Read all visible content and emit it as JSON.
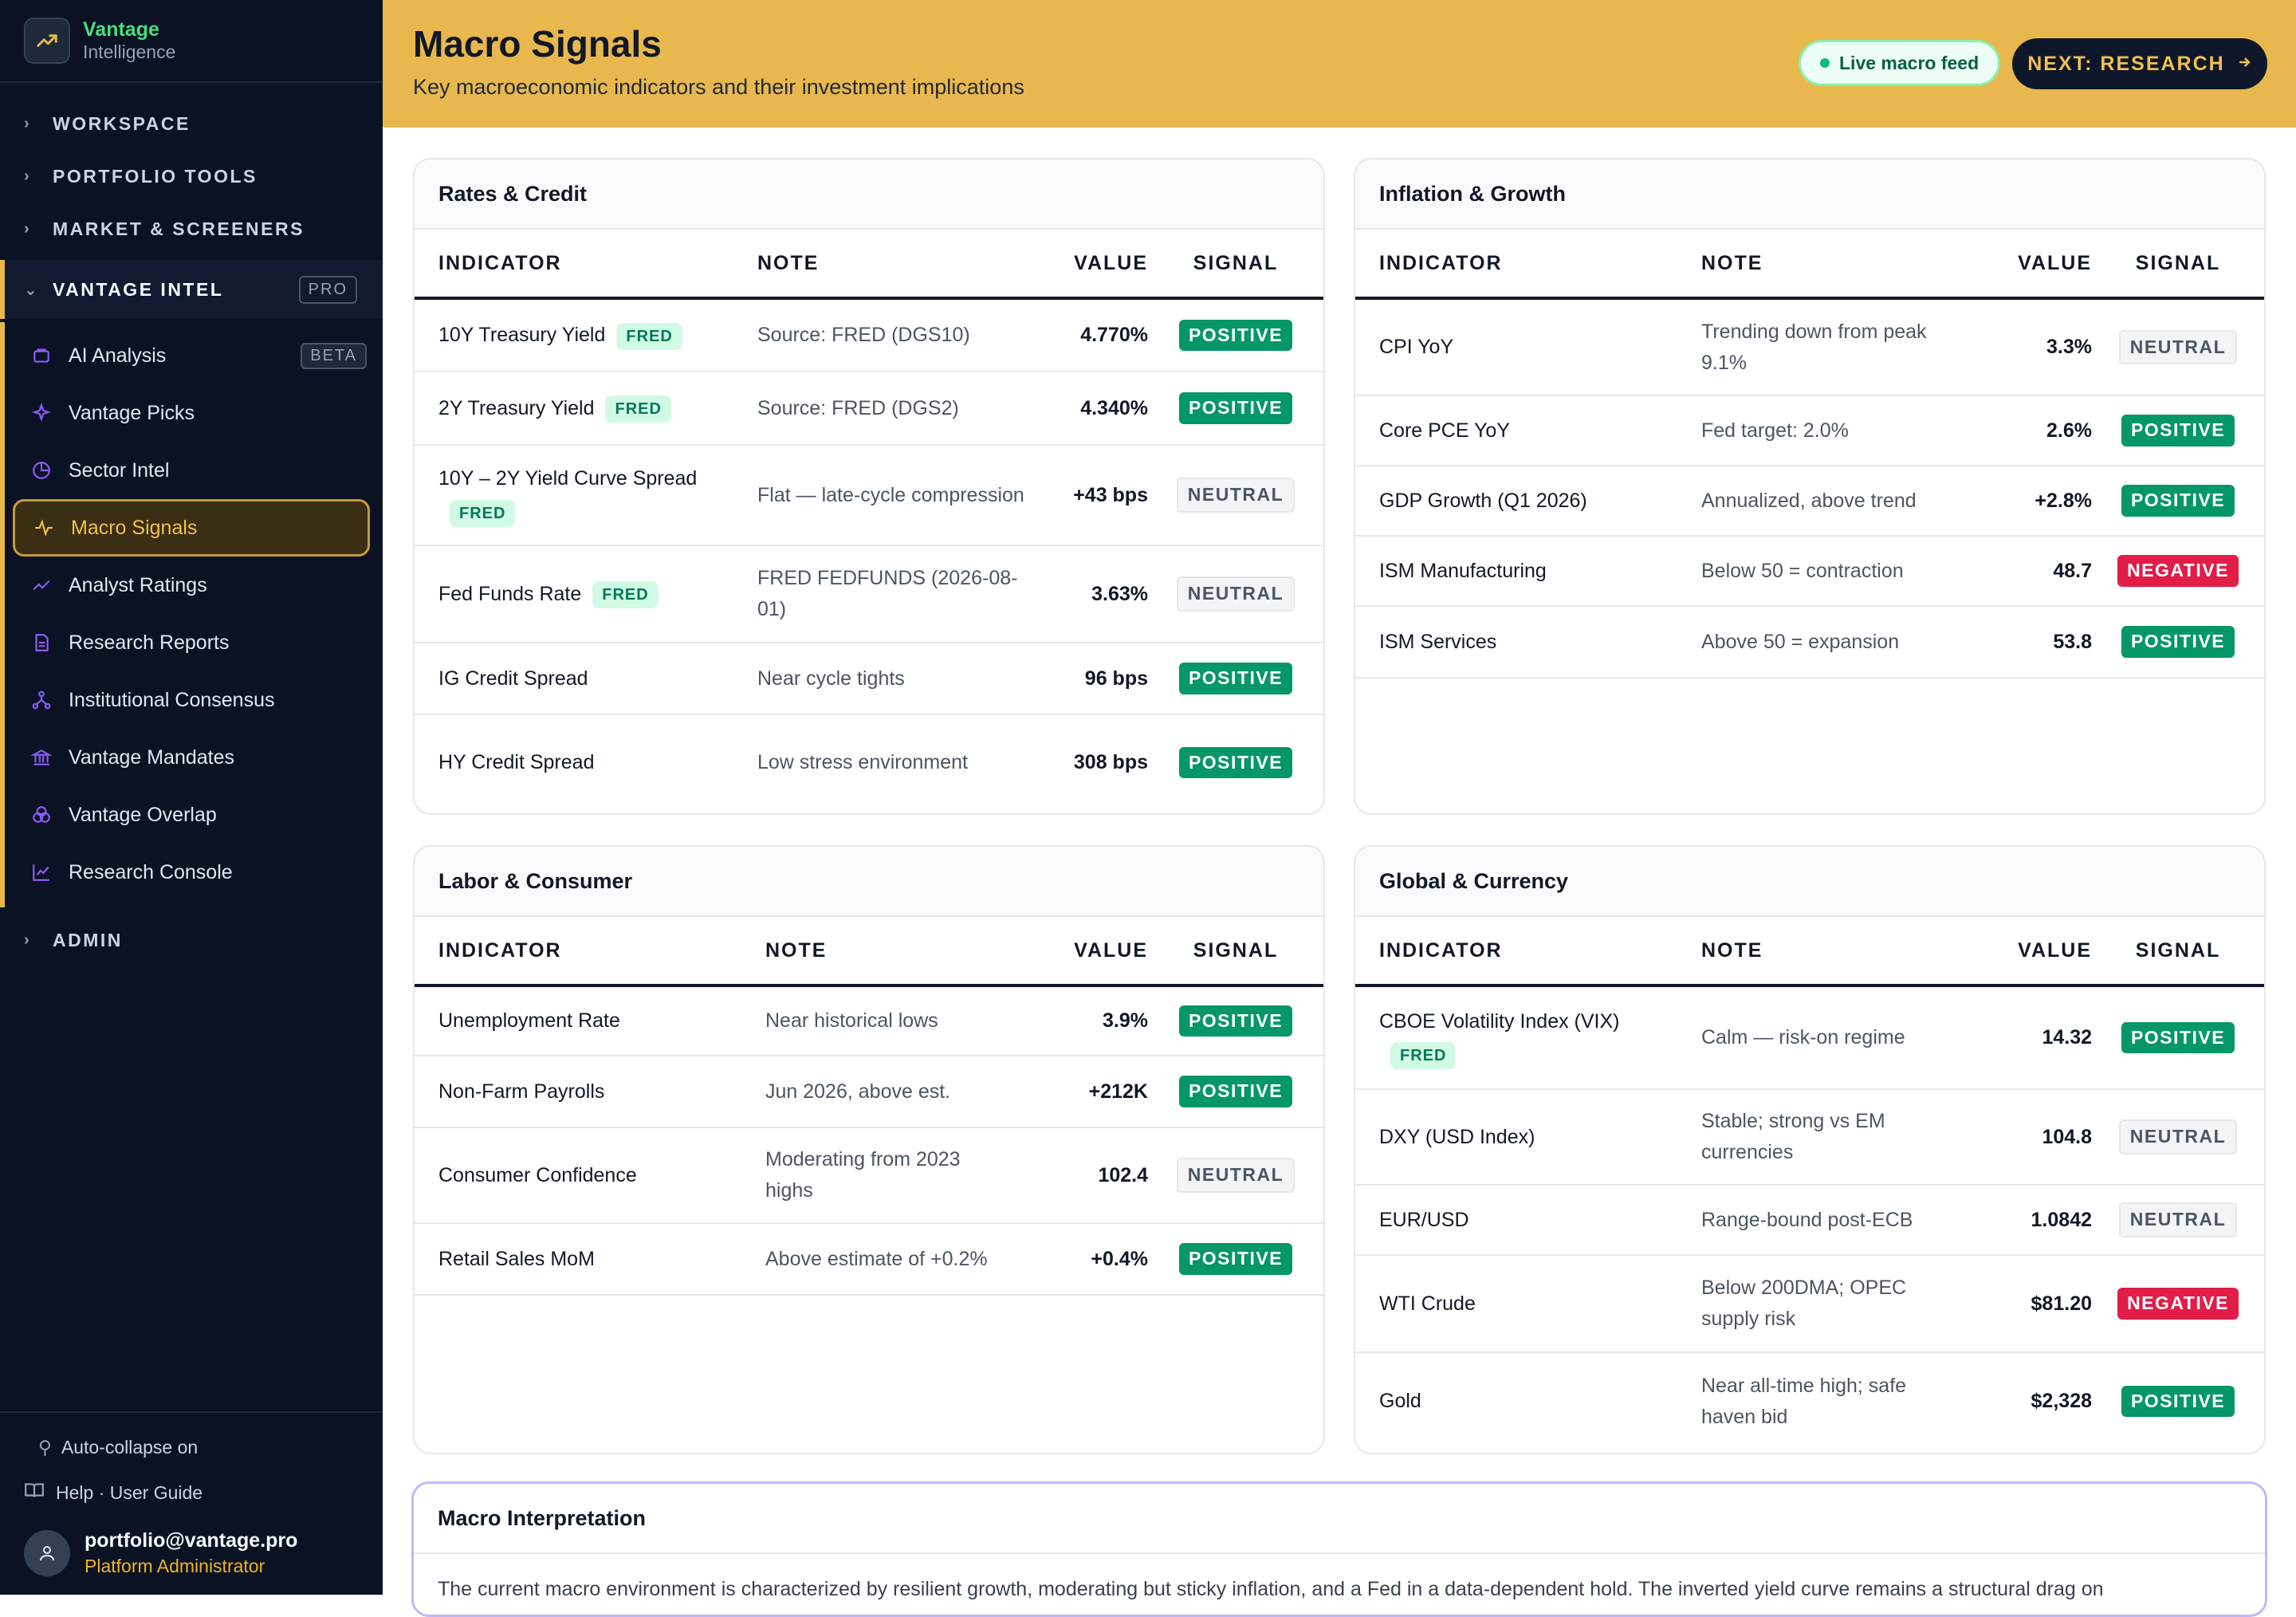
{
  "brand": {
    "name": "Vantage",
    "sub": "Intelligence"
  },
  "sidebar": {
    "sections": [
      "WORKSPACE",
      "PORTFOLIO TOOLS",
      "MARKET & SCREENERS"
    ],
    "active_section": "VANTAGE INTEL",
    "active_section_badge": "PRO",
    "items": [
      {
        "label": "AI Analysis",
        "icon": "ai-analysis-icon",
        "badge": "BETA"
      },
      {
        "label": "Vantage Picks",
        "icon": "sparkle-icon"
      },
      {
        "label": "Sector Intel",
        "icon": "pie-chart-icon"
      },
      {
        "label": "Macro Signals",
        "icon": "activity-icon"
      },
      {
        "label": "Analyst Ratings",
        "icon": "trending-up-icon"
      },
      {
        "label": "Research Reports",
        "icon": "document-icon"
      },
      {
        "label": "Institutional Consensus",
        "icon": "network-icon"
      },
      {
        "label": "Vantage Mandates",
        "icon": "bank-icon"
      },
      {
        "label": "Vantage Overlap",
        "icon": "overlap-icon"
      },
      {
        "label": "Research Console",
        "icon": "line-chart-icon"
      }
    ],
    "admin": "ADMIN",
    "footer": {
      "auto_collapse": "Auto-collapse on",
      "help": "Help · User Guide",
      "email": "portfolio@vantage.pro",
      "role": "Platform Administrator"
    }
  },
  "header": {
    "title": "Macro Signals",
    "subtitle": "Key macroeconomic indicators and their investment implications",
    "live_label": "Live macro feed",
    "next_label": "NEXT: RESEARCH"
  },
  "columns": {
    "indicator": "INDICATOR",
    "note": "NOTE",
    "value": "VALUE",
    "signal": "SIGNAL"
  },
  "signals": {
    "positive": "POSITIVE",
    "neutral": "NEUTRAL",
    "negative": "NEGATIVE"
  },
  "fred_label": "FRED",
  "cards": {
    "rates": {
      "title": "Rates & Credit",
      "rows": [
        {
          "indicator": "10Y Treasury Yield",
          "fred": true,
          "note": "Source: FRED (DGS10)",
          "value": "4.770%",
          "signal": "POSITIVE"
        },
        {
          "indicator": "2Y Treasury Yield",
          "fred": true,
          "note": "Source: FRED (DGS2)",
          "value": "4.340%",
          "signal": "POSITIVE"
        },
        {
          "indicator": "10Y – 2Y Yield Curve Spread",
          "fred": true,
          "note": "Flat — late-cycle compression",
          "value": "+43 bps",
          "signal": "NEUTRAL"
        },
        {
          "indicator": "Fed Funds Rate",
          "fred": true,
          "note": "FRED FEDFUNDS (2026-08-01)",
          "value": "3.63%",
          "signal": "NEUTRAL"
        },
        {
          "indicator": "IG Credit Spread",
          "fred": false,
          "note": "Near cycle tights",
          "value": "96 bps",
          "signal": "POSITIVE"
        },
        {
          "indicator": "HY Credit Spread",
          "fred": false,
          "note": "Low stress environment",
          "value": "308 bps",
          "signal": "POSITIVE"
        }
      ]
    },
    "inflation": {
      "title": "Inflation & Growth",
      "rows": [
        {
          "indicator": "CPI YoY",
          "note": "Trending down from peak 9.1%",
          "value": "3.3%",
          "signal": "NEUTRAL"
        },
        {
          "indicator": "Core PCE YoY",
          "note": "Fed target: 2.0%",
          "value": "2.6%",
          "signal": "POSITIVE"
        },
        {
          "indicator": "GDP Growth (Q1 2026)",
          "note": "Annualized, above trend",
          "value": "+2.8%",
          "signal": "POSITIVE"
        },
        {
          "indicator": "ISM Manufacturing",
          "note": "Below 50 = contraction",
          "value": "48.7",
          "signal": "NEGATIVE"
        },
        {
          "indicator": "ISM Services",
          "note": "Above 50 = expansion",
          "value": "53.8",
          "signal": "POSITIVE"
        }
      ]
    },
    "labor": {
      "title": "Labor & Consumer",
      "rows": [
        {
          "indicator": "Unemployment Rate",
          "note": "Near historical lows",
          "value": "3.9%",
          "signal": "POSITIVE"
        },
        {
          "indicator": "Non-Farm Payrolls",
          "note": "Jun 2026, above est.",
          "value": "+212K",
          "signal": "POSITIVE"
        },
        {
          "indicator": "Consumer Confidence",
          "note": "Moderating from 2023 highs",
          "value": "102.4",
          "signal": "NEUTRAL"
        },
        {
          "indicator": "Retail Sales MoM",
          "note": "Above estimate of +0.2%",
          "value": "+0.4%",
          "signal": "POSITIVE"
        }
      ]
    },
    "global": {
      "title": "Global & Currency",
      "rows": [
        {
          "indicator": "CBOE Volatility Index (VIX)",
          "fred": true,
          "note": "Calm — risk-on regime",
          "value": "14.32",
          "signal": "POSITIVE"
        },
        {
          "indicator": "DXY (USD Index)",
          "note": "Stable; strong vs EM currencies",
          "value": "104.8",
          "signal": "NEUTRAL"
        },
        {
          "indicator": "EUR/USD",
          "note": "Range-bound post-ECB",
          "value": "1.0842",
          "signal": "NEUTRAL"
        },
        {
          "indicator": "WTI Crude",
          "note": "Below 200DMA; OPEC supply risk",
          "value": "$81.20",
          "signal": "NEGATIVE"
        },
        {
          "indicator": "Gold",
          "note": "Near all-time high; safe haven bid",
          "value": "$2,328",
          "signal": "POSITIVE"
        }
      ]
    }
  },
  "interpretation": {
    "title": "Macro Interpretation",
    "text": "The current macro environment is characterized by resilient growth, moderating but sticky inflation, and a Fed in a data-dependent hold. The inverted yield curve remains a structural drag on"
  }
}
